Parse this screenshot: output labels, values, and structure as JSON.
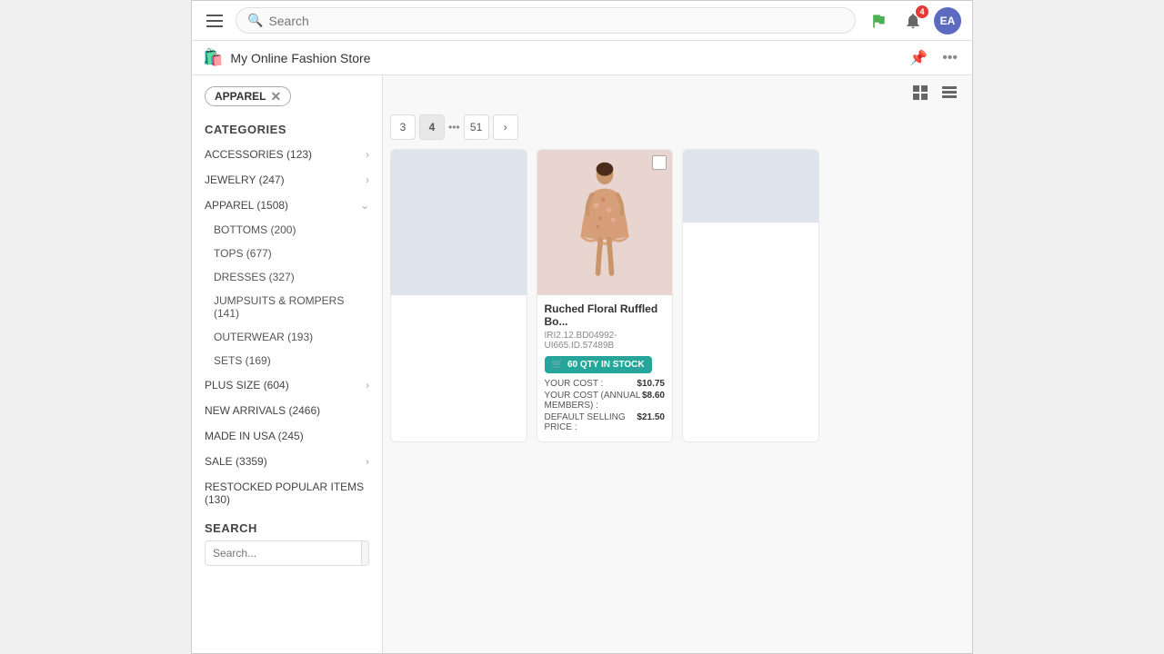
{
  "topbar": {
    "search_placeholder": "Search",
    "notification_count": "4",
    "avatar_initials": "EA"
  },
  "secondbar": {
    "store_icon": "🛍️",
    "store_name": "My Online Fashion Store"
  },
  "sidebar": {
    "filter_tag": "APPAREL",
    "categories_title": "CATEGORIES",
    "categories": [
      {
        "name": "ACCESSORIES (123)",
        "has_sub": true,
        "expanded": false
      },
      {
        "name": "JEWELRY (247)",
        "has_sub": true,
        "expanded": false
      },
      {
        "name": "APPAREL (1508)",
        "has_sub": true,
        "expanded": true
      },
      {
        "name": "PLUS SIZE (604)",
        "has_sub": true,
        "expanded": false
      },
      {
        "name": "NEW ARRIVALS (2466)",
        "has_sub": false,
        "expanded": false
      },
      {
        "name": "MADE IN USA (245)",
        "has_sub": false,
        "expanded": false
      },
      {
        "name": "SALE (3359)",
        "has_sub": true,
        "expanded": false
      },
      {
        "name": "RESTOCKED POPULAR ITEMS (130)",
        "has_sub": false,
        "expanded": false
      }
    ],
    "sub_categories": [
      "BOTTOMS (200)",
      "TOPS (677)",
      "DRESSES (327)",
      "JUMPSUITS & ROMPERS (141)",
      "OUTERWEAR (193)",
      "SETS (169)"
    ],
    "search_title": "SEARCH",
    "search_placeholder": "Search..."
  },
  "right_panel": {
    "view_icons": [
      "grid-view",
      "list-view"
    ],
    "pagination": {
      "pages": [
        "3",
        "4",
        "51"
      ],
      "active": "4",
      "has_next": true
    },
    "product": {
      "name": "Ruched Floral Ruffled Bo...",
      "sku": "IRI2.12.BD04992-UI665.ID.57489B",
      "stock_label": "60 QTY IN STOCK",
      "your_cost_label": "YOUR COST :",
      "your_cost_value": "$10.75",
      "annual_label": "YOUR COST (ANNUAL MEMBERS) :",
      "annual_value": "$8.60",
      "selling_label": "DEFAULT SELLING PRICE :",
      "selling_value": "$21.50"
    }
  }
}
